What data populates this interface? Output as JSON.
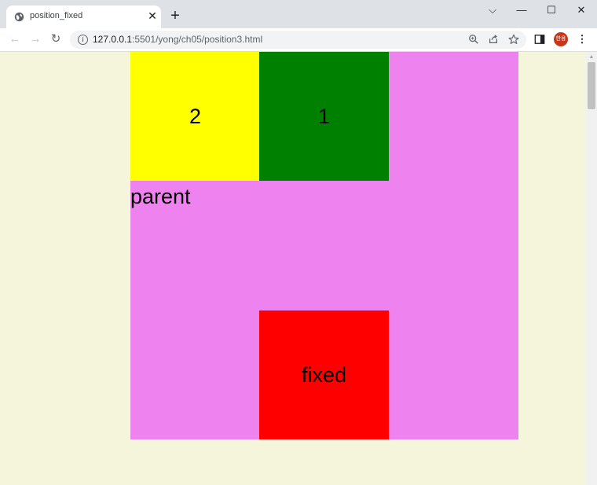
{
  "tab": {
    "title": "position_fixed",
    "close_label": "✕",
    "favicon_icon": "globe-icon"
  },
  "new_tab_label": "+",
  "window_controls": {
    "dropdown_label": "⌵",
    "minimize_label": "—",
    "maximize_label": "☐",
    "close_label": "✕"
  },
  "toolbar": {
    "back_label": "←",
    "forward_label": "→",
    "reload_label": "↻",
    "url_host": "127.0.0.1",
    "url_rest": ":5501/yong/ch05/position3.html",
    "avatar_label": "한용",
    "menu_label": "⋮"
  },
  "page": {
    "background": "#f5f5dc",
    "parent_label": "parent",
    "parent_color": "#ee82ee",
    "box_2_label": "2",
    "box_2_color": "#ffff00",
    "box_1_label": "1",
    "box_1_color": "#008000",
    "fixed_label": "fixed",
    "fixed_color": "#ff0000"
  }
}
